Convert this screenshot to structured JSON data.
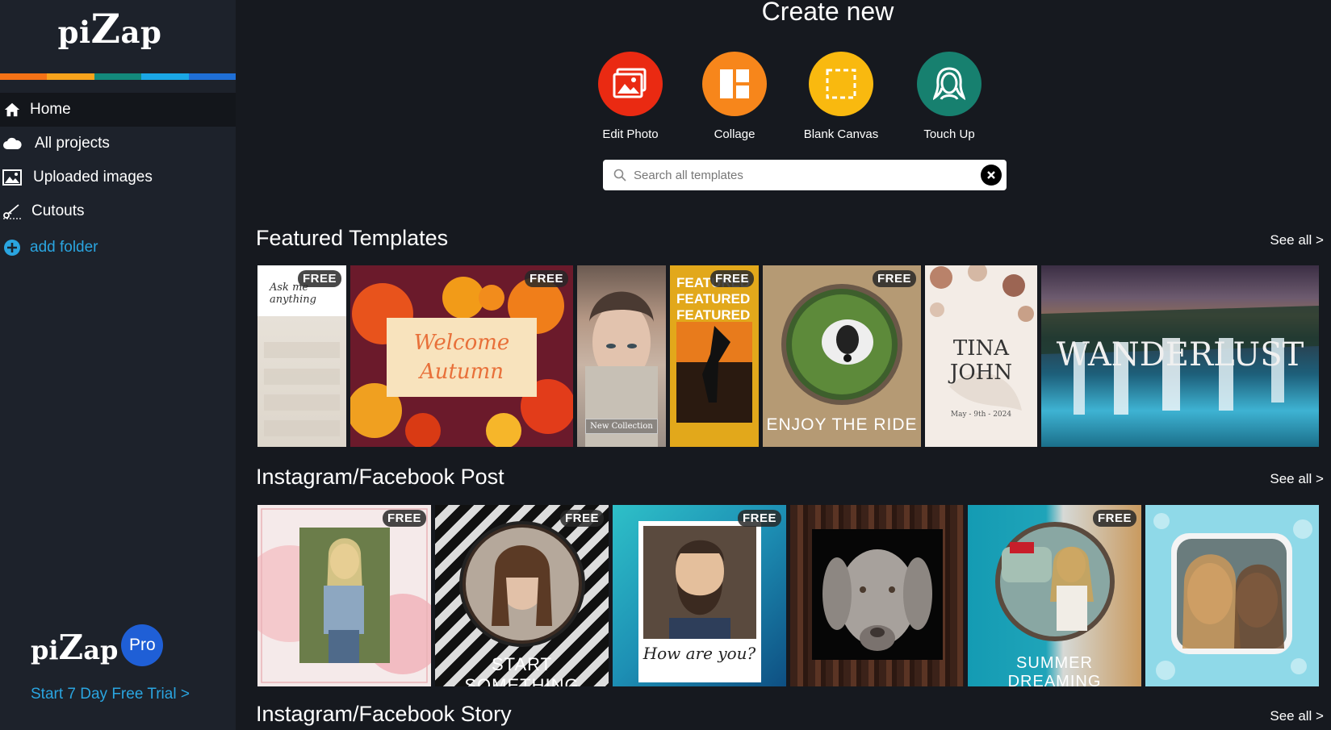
{
  "sidebar": {
    "logo": {
      "pre": "pi",
      "big": "Z",
      "post": "ap"
    },
    "nav": [
      {
        "label": "Home",
        "icon": "home-icon"
      },
      {
        "label": "All projects",
        "icon": "cloud-icon"
      },
      {
        "label": "Uploaded images",
        "icon": "image-icon"
      },
      {
        "label": "Cutouts",
        "icon": "scissors-icon"
      },
      {
        "label": "add folder",
        "icon": "plus-circle-icon"
      }
    ],
    "pro": {
      "logo_pre": "pi",
      "logo_big": "Z",
      "logo_post": "ap",
      "badge": "Pro",
      "trial": "Start 7 Day Free Trial >"
    },
    "color_bar": [
      "#f47216",
      "#f7a31c",
      "#13897b",
      "#1aa7e6",
      "#1f6fd6"
    ]
  },
  "create": {
    "title": "Create new",
    "buttons": [
      {
        "label": "Edit Photo",
        "color": "#ea2a12",
        "icon": "photo-icon"
      },
      {
        "label": "Collage",
        "color": "#f7861b",
        "icon": "collage-icon"
      },
      {
        "label": "Blank Canvas",
        "color": "#f9b90f",
        "icon": "blank-canvas-icon"
      },
      {
        "label": "Touch Up",
        "color": "#17806f",
        "icon": "face-icon"
      }
    ],
    "search_placeholder": "Search all templates"
  },
  "sections": [
    {
      "title": "Featured Templates",
      "see_all": "See all >",
      "tiles": [
        {
          "badge": "FREE",
          "text": "Ask me anything"
        },
        {
          "badge": "FREE",
          "text": "Welcome Autumn"
        },
        {
          "badge": "",
          "text": "New Collection"
        },
        {
          "badge": "FREE",
          "text": "FEATURED"
        },
        {
          "badge": "FREE",
          "text": "ENJOY THE RIDE"
        },
        {
          "badge": "",
          "text": "TINA JOHN",
          "sub": "May - 9th - 2024"
        },
        {
          "badge": "",
          "text": "WANDERLUST"
        }
      ]
    },
    {
      "title": "Instagram/Facebook Post",
      "see_all": "See all >",
      "tiles": [
        {
          "badge": "FREE",
          "text": ""
        },
        {
          "badge": "FREE",
          "text": "START SOMETHING"
        },
        {
          "badge": "FREE",
          "text": "How are you?"
        },
        {
          "badge": "",
          "text": ""
        },
        {
          "badge": "FREE",
          "text": "SUMMER DREAMING"
        },
        {
          "badge": "",
          "text": ""
        }
      ]
    },
    {
      "title": "Instagram/Facebook Story",
      "see_all": "See all >"
    }
  ]
}
